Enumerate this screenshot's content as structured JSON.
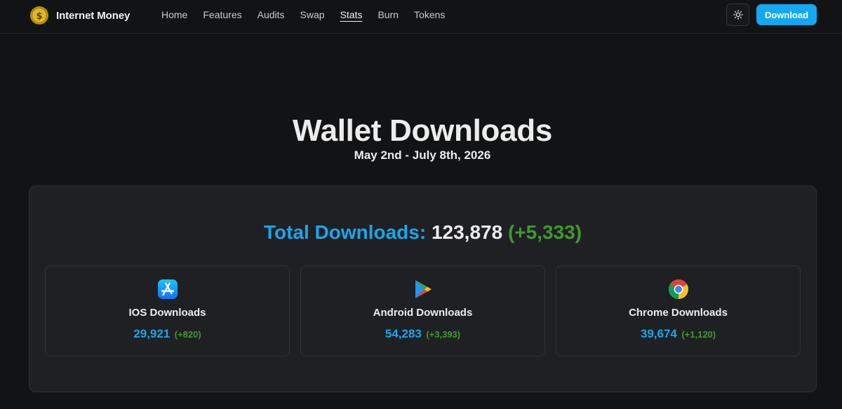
{
  "header": {
    "brand": "Internet Money",
    "nav": [
      "Home",
      "Features",
      "Audits",
      "Swap",
      "Stats",
      "Burn",
      "Tokens"
    ],
    "active_nav": "Stats",
    "theme_toggle_icon": "sun-icon",
    "download_label": "Download"
  },
  "page": {
    "title": "Wallet Downloads",
    "subtitle": "May 2nd - July 8th, 2026"
  },
  "stats": {
    "total_label": "Total Downloads:",
    "total_value": "123,878",
    "total_delta": "(+5,333)",
    "cards": [
      {
        "icon": "app-store-icon",
        "title": "IOS Downloads",
        "count": "29,921",
        "delta": "(+820)"
      },
      {
        "icon": "google-play-icon",
        "title": "Android Downloads",
        "count": "54,283",
        "delta": "(+3,393)"
      },
      {
        "icon": "chrome-icon",
        "title": "Chrome Downloads",
        "count": "39,674",
        "delta": "(+1,120)"
      }
    ]
  },
  "colors": {
    "background": "#121314",
    "accent": "#1ba6ea",
    "positive": "#3f9a2e",
    "button": "#14a8f2"
  }
}
